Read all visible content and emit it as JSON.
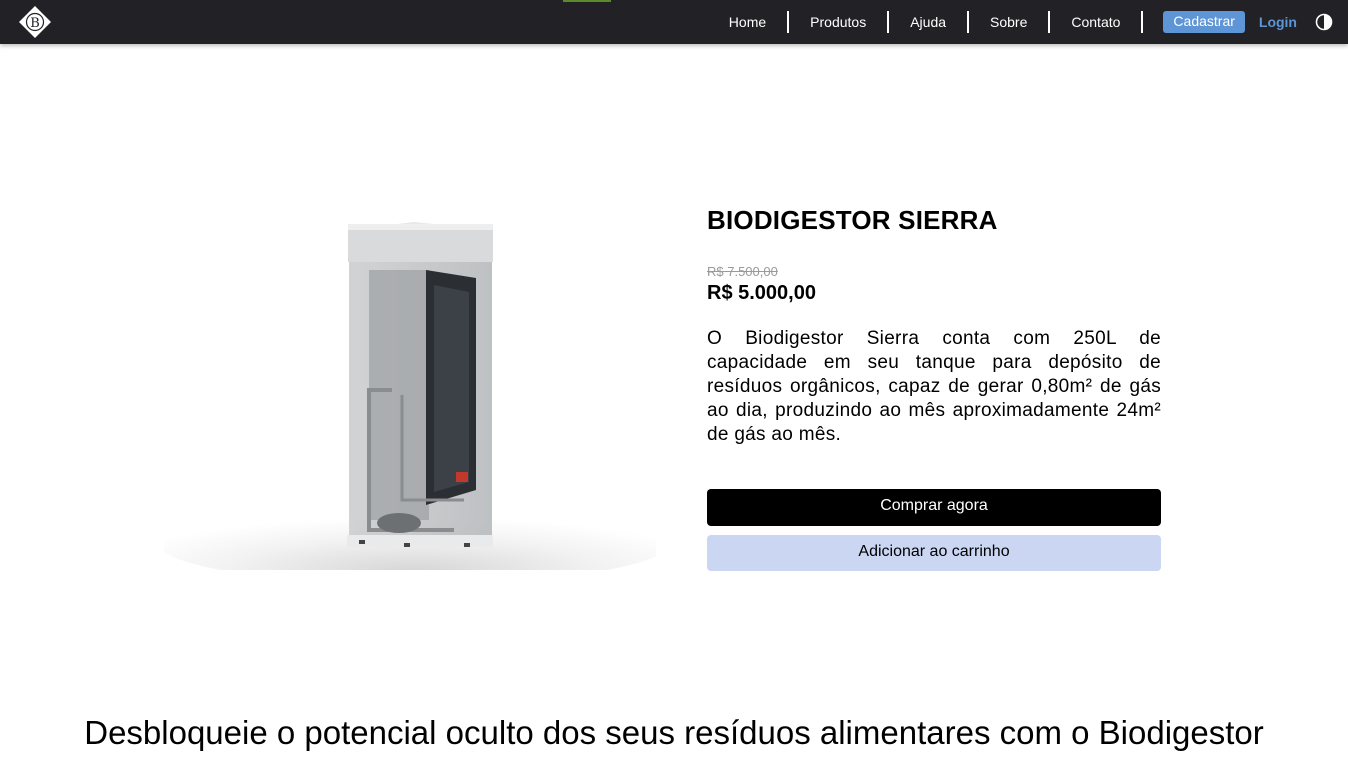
{
  "header": {
    "logo_icon": "biodigestor-diamond-logo",
    "nav": [
      "Home",
      "Produtos",
      "Ajuda",
      "Sobre",
      "Contato"
    ],
    "signup_label": "Cadastrar",
    "login_label": "Login",
    "theme_icon": "contrast-icon",
    "colors": {
      "bar": "#212126",
      "accent": "#5d95d6"
    }
  },
  "product": {
    "title": "BIODIGESTOR SIERRA",
    "old_price": "R$ 7.500,00",
    "price": "R$ 5.000,00",
    "description": "O Biodigestor Sierra conta com 250L de capacidade em seu tanque para depósito de resíduos orgânicos, capaz de gerar 0,80m² de gás ao dia, produzindo ao mês aproximadamente 24m² de gás ao mês.",
    "buy_label": "Comprar agora",
    "cart_label": "Adicionar ao carrinho"
  },
  "section": {
    "heading": "Desbloqueie o potencial oculto dos seus resíduos alimentares com o Biodigestor"
  }
}
